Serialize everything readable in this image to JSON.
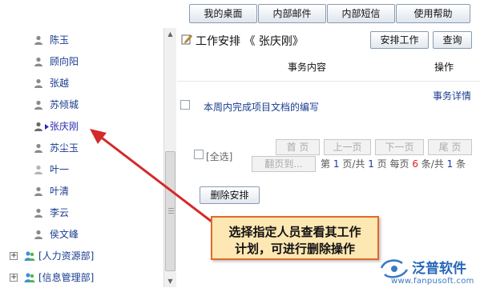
{
  "topnav": {
    "buttons": [
      "我的桌面",
      "内部邮件",
      "内部短信",
      "使用帮助"
    ]
  },
  "sidebar": {
    "users": [
      {
        "name": "陈玉"
      },
      {
        "name": "顾向阳"
      },
      {
        "name": "张越"
      },
      {
        "name": "苏倾城"
      },
      {
        "name": "张庆刚",
        "selected": true
      },
      {
        "name": "苏尘玉"
      },
      {
        "name": "叶一"
      },
      {
        "name": "叶清"
      },
      {
        "name": "李云"
      },
      {
        "name": "侯文峰"
      }
    ],
    "departments": [
      {
        "label": "[人力资源部]",
        "expander": "+"
      },
      {
        "label": "[信息管理部]",
        "expander": "+"
      }
    ]
  },
  "main": {
    "title": "工作安排 《 张庆刚》",
    "buttons": {
      "arrange": "安排工作",
      "query": "查询"
    },
    "columns": {
      "content": "事务内容",
      "action": "操作"
    },
    "task": {
      "text": "本周内完成项目文档的编写",
      "detail_link": "事务详情"
    },
    "select_all": "[全选]",
    "pagination": {
      "first": "首 页",
      "prev": "上一页",
      "next": "下一页",
      "last": "尾 页",
      "jump": "翻页到...",
      "info": {
        "p1": "第",
        "current": "1",
        "p2": "页/共",
        "total_pages": "1",
        "p3": "页 每页",
        "per_page": "6",
        "p4": "条/共",
        "total": "1",
        "p5": "条"
      }
    },
    "delete_button": "删除安排"
  },
  "callout": {
    "line1": "选择指定人员查看其工作",
    "line2": "计划，可进行删除操作"
  },
  "watermark": {
    "name": "泛普软件",
    "url": "www.fanpusoft.com"
  },
  "colors": {
    "link": "#1a3d8f",
    "arrow": "#d42a2a",
    "callout_bg": "#fde7b3",
    "callout_border": "#e06a2a",
    "brand": "#2566b8"
  }
}
